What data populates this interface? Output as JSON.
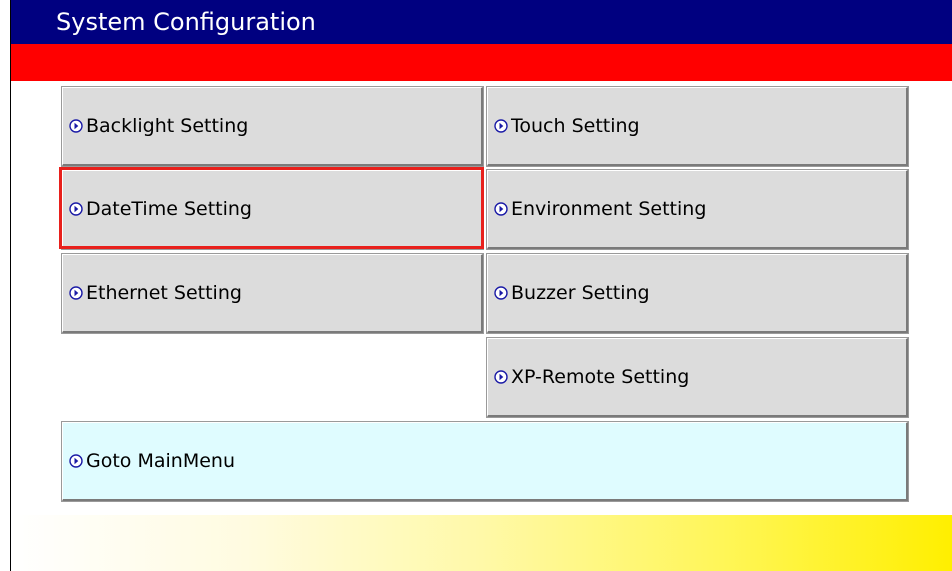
{
  "window": {
    "title": "System Configuration"
  },
  "menu": {
    "backlight": "Backlight Setting",
    "touch": "Touch Setting",
    "datetime": "DateTime Setting",
    "environment": "Environment Setting",
    "ethernet": "Ethernet Setting",
    "buzzer": "Buzzer Setting",
    "xp_remote": "XP-Remote Setting",
    "goto_main": "Goto MainMenu"
  },
  "state": {
    "selected_item": "DateTime Setting"
  },
  "icons": {
    "menu_item_icon": "circle-arrow-right-icon"
  },
  "colors": {
    "title_bar": "#000080",
    "title_text": "#ffffff",
    "accent_bar": "#ff0000",
    "button_face": "#dcdcdc",
    "main_menu_button_face": "#dffcff",
    "selection_highlight": "#e8201c",
    "icon_fill": "#1a1aa6",
    "footer_gradient_end": "#ffef00"
  }
}
